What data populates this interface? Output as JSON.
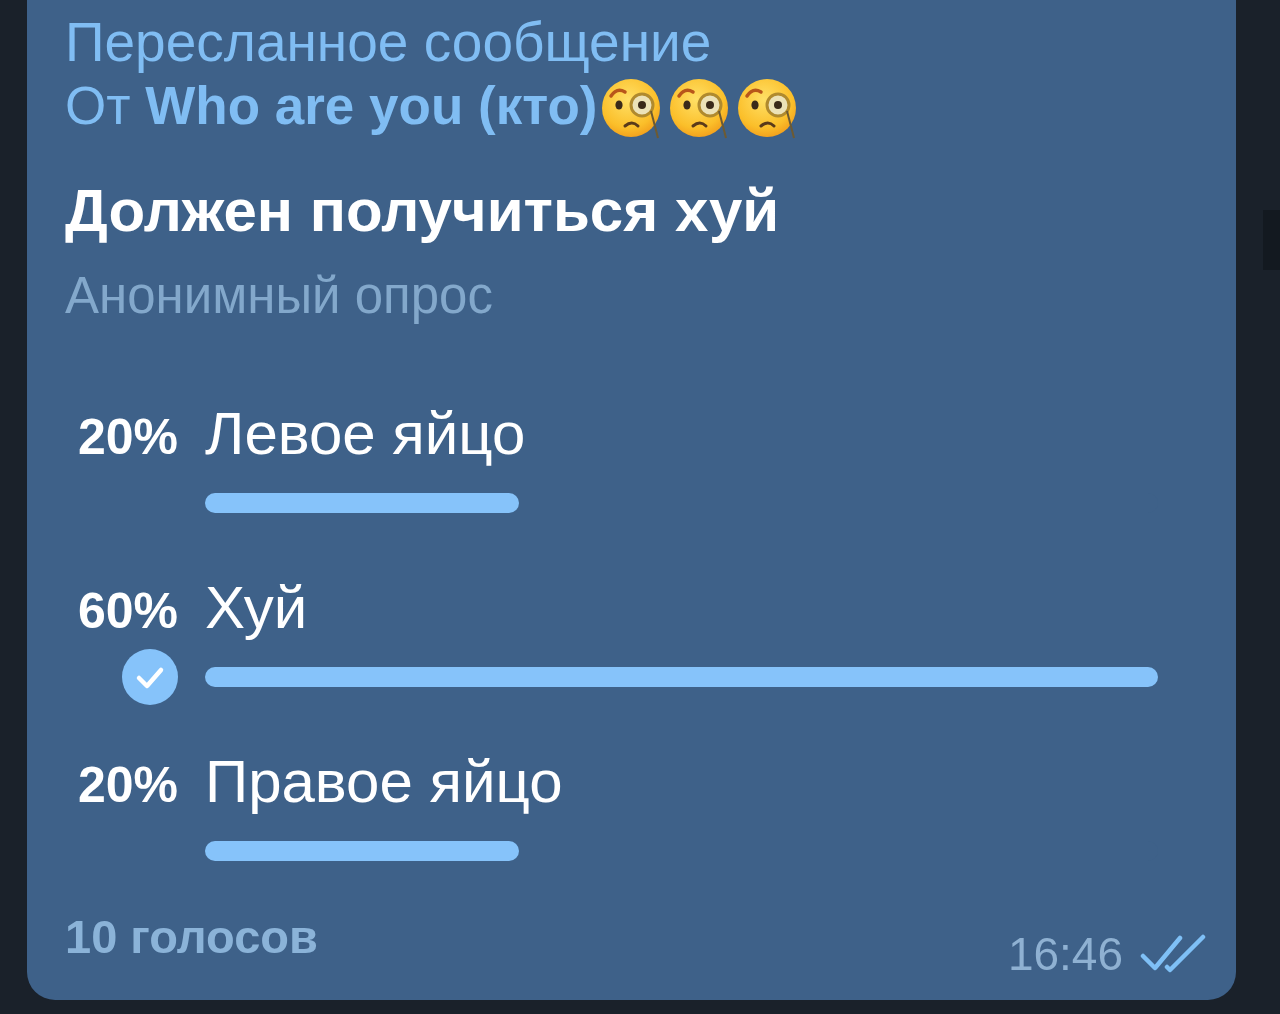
{
  "forward_header": {
    "label": "Пересланное сообщение",
    "from": "От **Who are you (кто)**"
  },
  "poll": {
    "question": "Должен получиться хуй",
    "type_label": "Анонимный опрос",
    "options": [
      {
        "percent": "20%",
        "text": "Левое яйцо",
        "level": 0.33,
        "selected": false
      },
      {
        "percent": "60%",
        "text": "Хуй",
        "level": 1,
        "selected": true
      },
      {
        "percent": "20%",
        "text": "Правое яйцо",
        "level": 0.33,
        "selected": false
      }
    ],
    "total_votes": "10 голосов"
  },
  "message": {
    "time": "16:46",
    "read": true
  }
}
